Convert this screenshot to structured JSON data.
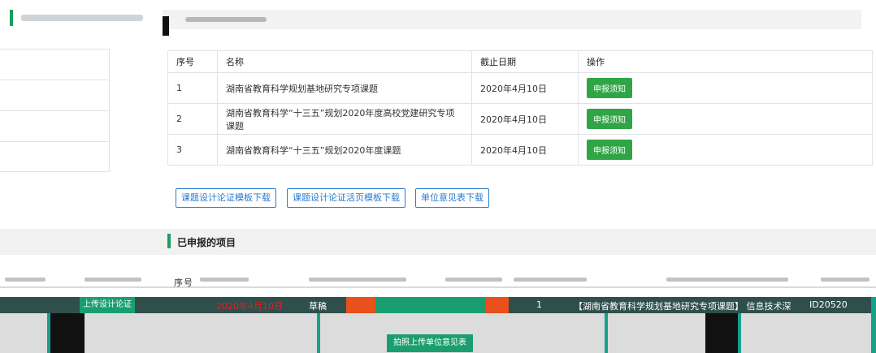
{
  "notices": {
    "headers": {
      "index": "序号",
      "name": "名称",
      "deadline": "截止日期",
      "action": "操作"
    },
    "rows": [
      {
        "index": "1",
        "name": "湖南省教育科学规划基地研究专项课题",
        "deadline": "2020年4月10日",
        "action": "申报须知"
      },
      {
        "index": "2",
        "name": "湖南省教育科学“十三五”规划2020年度高校党建研究专项课题",
        "deadline": "2020年4月10日",
        "action": "申报须知"
      },
      {
        "index": "3",
        "name": "湖南省教育科学“十三五”规划2020年度课题",
        "deadline": "2020年4月10日",
        "action": "申报须知"
      }
    ]
  },
  "downloads": {
    "design_template": "课题设计论证模板下载",
    "design_activity_template": "课题设计论证活页模板下载",
    "unit_opinion": "单位意见表下载"
  },
  "submitted": {
    "title": "已申报的项目",
    "header_seq": "序号",
    "row": {
      "date": "2020年4月10日",
      "status": "草稿",
      "seq": "1",
      "project_name": "【湖南省教育科学规划基地研究专项课题】 信息技术深",
      "id_prefix": "ID20520",
      "upload_label": "上传设计论证",
      "photo_upload_label": "拍照上传单位意见表"
    }
  },
  "colors": {
    "accent_green": "#1a9e5f",
    "button_green": "#2fa545",
    "link_blue": "#2a7ad0",
    "deadline_red": "#e02020"
  }
}
